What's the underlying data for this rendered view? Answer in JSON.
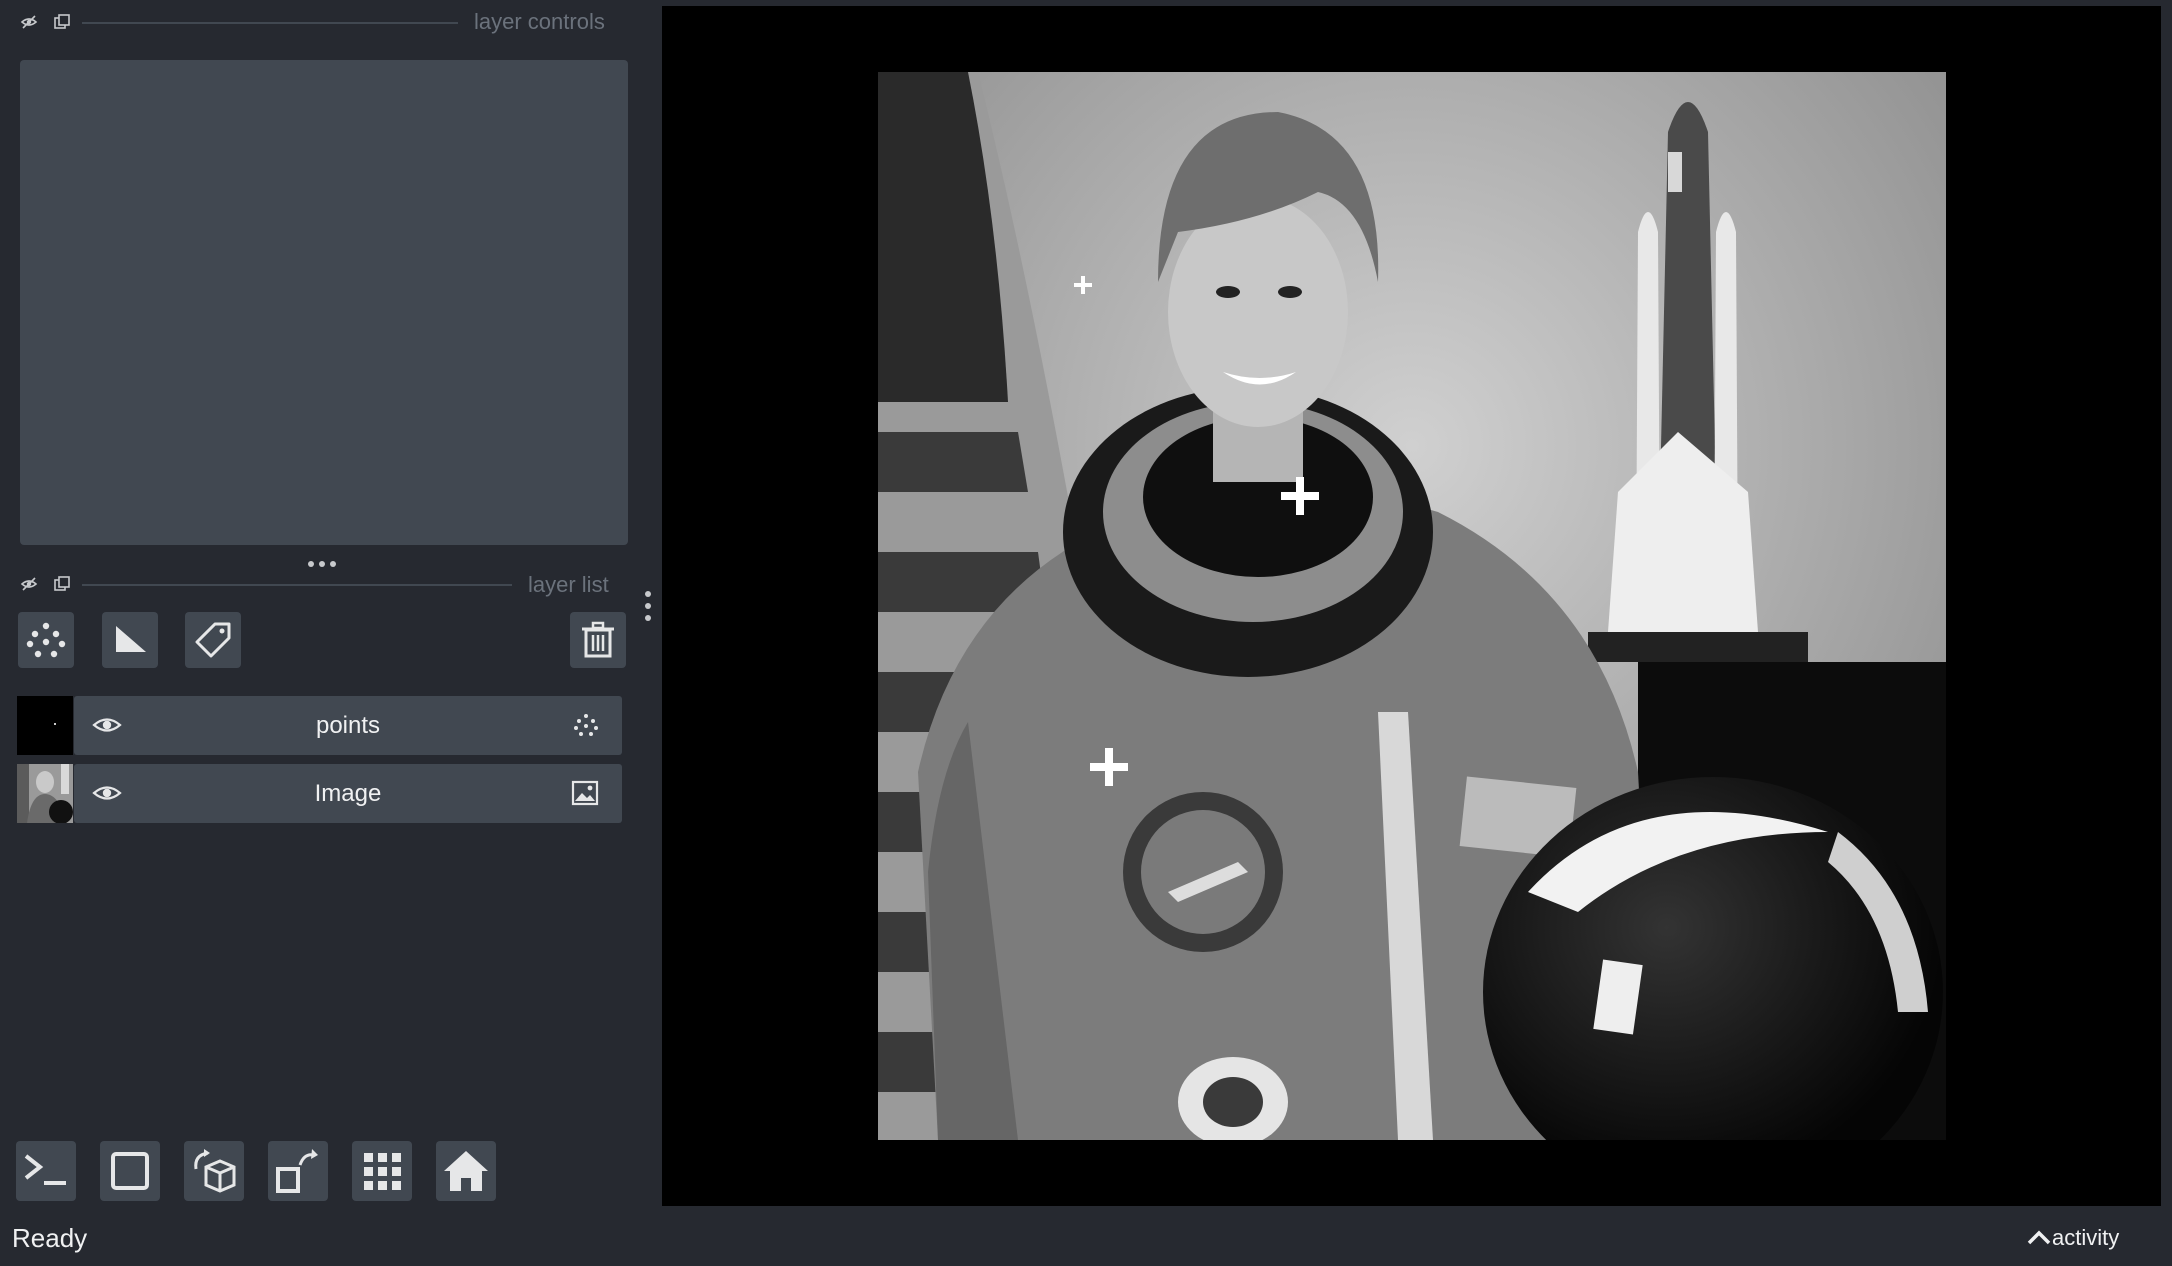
{
  "layer_controls": {
    "title": "layer controls"
  },
  "layer_list": {
    "title": "layer list",
    "layers": [
      {
        "name": "points",
        "type_icon": "points-icon",
        "visible": true
      },
      {
        "name": "Image",
        "type_icon": "image-icon",
        "visible": true
      }
    ]
  },
  "layer_buttons": {
    "new_points": "new-points-layer-icon",
    "new_shapes": "new-shapes-layer-icon",
    "new_labels": "new-labels-layer-icon",
    "delete": "delete-layer-icon"
  },
  "viewer_buttons": [
    "console-icon",
    "ndisplay-icon",
    "roll-dims-icon",
    "transpose-icon",
    "grid-icon",
    "home-icon"
  ],
  "status": {
    "text": "Ready",
    "activity": "activity"
  },
  "colors": {
    "bg": "#262930",
    "panel": "#414851",
    "text": "#f0f1f2",
    "canvas": "#000000"
  }
}
